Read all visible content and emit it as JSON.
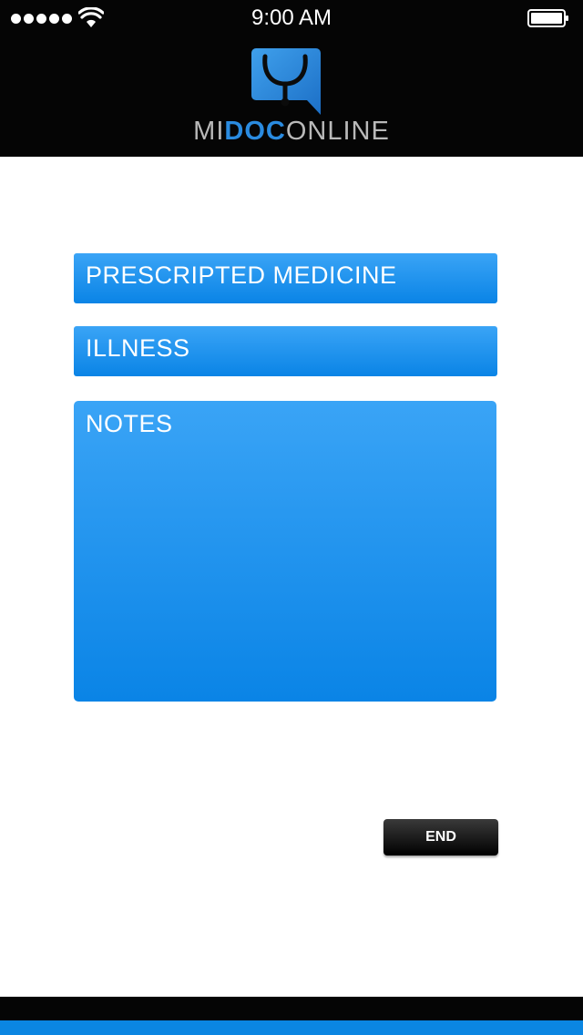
{
  "status_bar": {
    "time": "9:00 AM",
    "signal_icon": "signal-dots-icon",
    "wifi_icon": "wifi-icon",
    "battery_icon": "battery-icon"
  },
  "brand": {
    "logo_icon": "stethoscope-chat-bubble-icon",
    "name_prefix": "MI",
    "name_highlight": "DOC",
    "name_suffix": "ONLINE",
    "highlight_color": "#2a8be0",
    "text_color": "#b9b9b9"
  },
  "form": {
    "prescripted_medicine_placeholder": "PRESCRIPTED MEDICINE",
    "illness_placeholder": "ILLNESS",
    "notes_placeholder": "NOTES",
    "field_color": "#1e93ee"
  },
  "actions": {
    "end_label": "END"
  },
  "footer": {
    "bar_color": "#0b86e2"
  }
}
